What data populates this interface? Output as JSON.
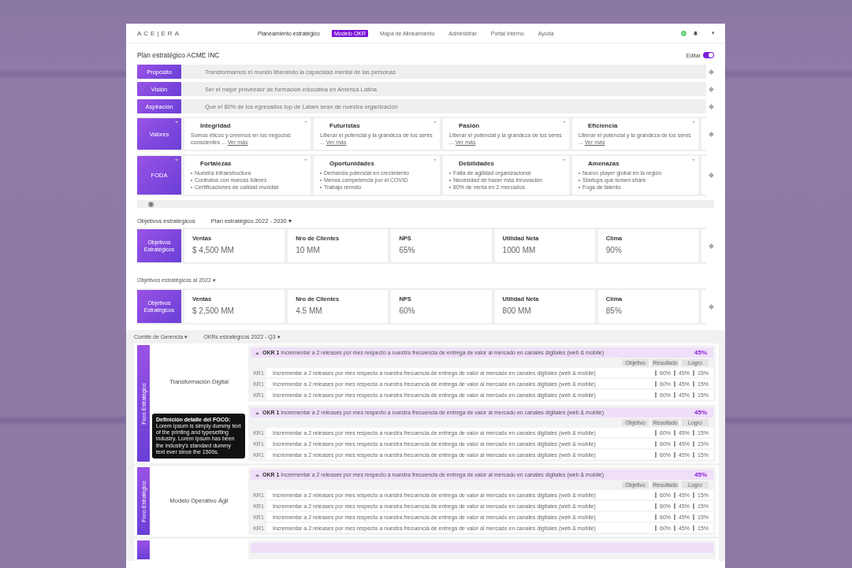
{
  "nav": {
    "logo": "ACE|ERA",
    "items": [
      {
        "label": "Planeamiento estratégico",
        "selected": false
      },
      {
        "label": "Modelo OKR",
        "selected": true
      },
      {
        "label": "Mapa de Alineamiento",
        "selected": false
      },
      {
        "label": "Administrar",
        "selected": false
      },
      {
        "label": "Portal Interno",
        "selected": false
      },
      {
        "label": "Ayuda",
        "selected": false
      }
    ],
    "menu_caret": "▾"
  },
  "plan": {
    "title": "Plan estratégico ACME INC",
    "edit_label": "Editar",
    "edit_on": true
  },
  "statements": [
    {
      "label": "Propósito",
      "text": "Transformamos el mundo liberando la capacidad mental de las personas"
    },
    {
      "label": "Visión",
      "text": "Ser el mejor proveedor de formación educativa en América Latina"
    },
    {
      "label": "Aspiración",
      "text": "Que el 80% de los egresados top de Latam sean de nuestra organización"
    }
  ],
  "valores": {
    "label": "Valores",
    "cards": [
      {
        "title": "Integridad",
        "text": "Somos éticos y creemos en los negocios conscientes ...",
        "link": "Ver más"
      },
      {
        "title": "Futuristas",
        "text": "Liberar el potencial y la grandeza de los seres ...",
        "link": "Ver más"
      },
      {
        "title": "Pasión",
        "text": "Liberar el potencial y la grandeza de los seres ...",
        "link": "Ver más"
      },
      {
        "title": "Eficiencia",
        "text": "Liberar el potencial y la grandeza de los seres ...",
        "link": "Ver más"
      }
    ]
  },
  "foda": {
    "label": "FODA",
    "cards": [
      {
        "title": "Fortalezas",
        "bullets": [
          "Nuestra infraestructura",
          "Contratos con marcas líderes",
          "Certificaciones de calidad mundial"
        ]
      },
      {
        "title": "Oportunidades",
        "bullets": [
          "Demanda potencial en crecimiento",
          "Menos competencia por el COVID",
          "Trabajo remoto"
        ]
      },
      {
        "title": "Debilidades",
        "bullets": [
          "Falta de agilidad organizacional",
          "Necesidad de hacer más innovación",
          "80% de venta en 2 mercados"
        ]
      },
      {
        "title": "Amenazas",
        "bullets": [
          "Nuevo player global en la región",
          "Startups que tomen share",
          "Fuga de talento"
        ]
      }
    ]
  },
  "objectives": {
    "label": "Objetivos estratégicos",
    "plan_dropdown": "Plan estratégico 2022 - 2030 ▾",
    "groups": [
      {
        "badge": "Objetivos Estratégicos",
        "metrics": [
          {
            "name": "Ventas",
            "value": "$ 4,500 MM"
          },
          {
            "name": "Nro de Clientes",
            "value": "10 MM"
          },
          {
            "name": "NPS",
            "value": "65%"
          },
          {
            "name": "Utilidad Neta",
            "value": "1000 MM"
          },
          {
            "name": "Clima",
            "value": "90%"
          }
        ]
      },
      {
        "heading": "Objetivos estratégicos al 2022 ▾",
        "badge": "Objetivos Estratégicos",
        "metrics": [
          {
            "name": "Ventas",
            "value": "$ 2,500 MM"
          },
          {
            "name": "Nro de Clientes",
            "value": "4.5 MM"
          },
          {
            "name": "NPS",
            "value": "60%"
          },
          {
            "name": "Utilidad Neta",
            "value": "800 MM"
          },
          {
            "name": "Clima",
            "value": "85%"
          }
        ]
      }
    ]
  },
  "okrs": {
    "committee": "Comité de Gerencia ▾",
    "period": "OKRs estratégicos 2022 - Q3 ▾",
    "more_below": true,
    "focos": [
      {
        "bar_label": "Foco Estratégico",
        "name": "Transformación Digital",
        "objectives": [
          {
            "code": "OKR 1",
            "text": "Incrementar a 2 releases por mes respecto a nuestra frecuencia de entrega de valor al mercado en canales digitales (web & mobile)",
            "progress": "45%",
            "columns": [
              "Objetivo",
              "Resultado",
              "Logro"
            ],
            "results": [
              {
                "code": "KR1",
                "text": "Incrementar a 2 releases por mes respecto a nuestra frecuencia de entrega de valor al mercado en canales digitales (web & mobile)",
                "target": "60%",
                "result": "45%",
                "achievement": "15%"
              },
              {
                "code": "KR1",
                "text": "Incrementar a 2 releases por mes respecto a nuestra frecuencia de entrega de valor al mercado en canales digitales (web & mobile)",
                "target": "60%",
                "result": "45%",
                "achievement": "15%"
              },
              {
                "code": "KR1",
                "text": "Incrementar a 2 releases por mes respecto a nuestra frecuencia de entrega de valor al mercado en canales digitales (web & mobile)",
                "target": "60%",
                "result": "45%",
                "achievement": "15%"
              }
            ]
          },
          {
            "code": "OKR 1",
            "text": "Incrementar a 2 releases por mes respecto a nuestra frecuencia de entrega de valor al mercado en canales digitales (web & mobile)",
            "progress": "45%",
            "columns": [
              "Objetivo",
              "Resultado",
              "Logro"
            ],
            "results": [
              {
                "code": "KR1",
                "text": "Incrementar a 2 releases por mes respecto a nuestra frecuencia de entrega de valor al mercado en canales digitales (web & mobile)",
                "target": "60%",
                "result": "45%",
                "achievement": "15%"
              },
              {
                "code": "KR1",
                "text": "Incrementar a 2 releases por mes respecto a nuestra frecuencia de entrega de valor al mercado en canales digitales (web & mobile)",
                "target": "60%",
                "result": "45%",
                "achievement": "15%"
              },
              {
                "code": "KR1",
                "text": "Incrementar a 2 releases por mes respecto a nuestra frecuencia de entrega de valor al mercado en canales digitales (web & mobile)",
                "target": "60%",
                "result": "45%",
                "achievement": "15%"
              }
            ]
          }
        ],
        "tooltip": {
          "title": "Definición detalle del FOCO:",
          "text": "Lorem Ipsum is simply dummy text of the printing and typesetting industry. Lorem Ipsum has been the industry's standard dummy text ever since the 1500s."
        }
      },
      {
        "bar_label": "Foco Estratégico",
        "name": "Modelo Operativo Ágil",
        "objectives": [
          {
            "code": "OKR 1",
            "text": "Incrementar a 2 releases por mes respecto a nuestra frecuencia de entrega de valor al mercado en canales digitales (web & mobile)",
            "progress": "45%",
            "columns": [
              "Objetivo",
              "Resultado",
              "Logro"
            ],
            "results": [
              {
                "code": "KR1",
                "text": "Incrementar a 2 releases por mes respecto a nuestra frecuencia de entrega de valor al mercado en canales digitales (web & mobile)",
                "target": "60%",
                "result": "45%",
                "achievement": "15%"
              },
              {
                "code": "KR1",
                "text": "Incrementar a 2 releases por mes respecto a nuestra frecuencia de entrega de valor al mercado en canales digitales (web & mobile)",
                "target": "60%",
                "result": "45%",
                "achievement": "15%"
              },
              {
                "code": "KR1",
                "text": "Incrementar a 2 releases por mes respecto a nuestra frecuencia de entrega de valor al mercado en canales digitales (web & mobile)",
                "target": "60%",
                "result": "45%",
                "achievement": "15%"
              },
              {
                "code": "KR1",
                "text": "Incrementar a 2 releases por mes respecto a nuestra frecuencia de entrega de valor al mercado en canales digitales (web & mobile)",
                "target": "60%",
                "result": "45%",
                "achievement": "15%"
              }
            ]
          }
        ]
      }
    ]
  }
}
